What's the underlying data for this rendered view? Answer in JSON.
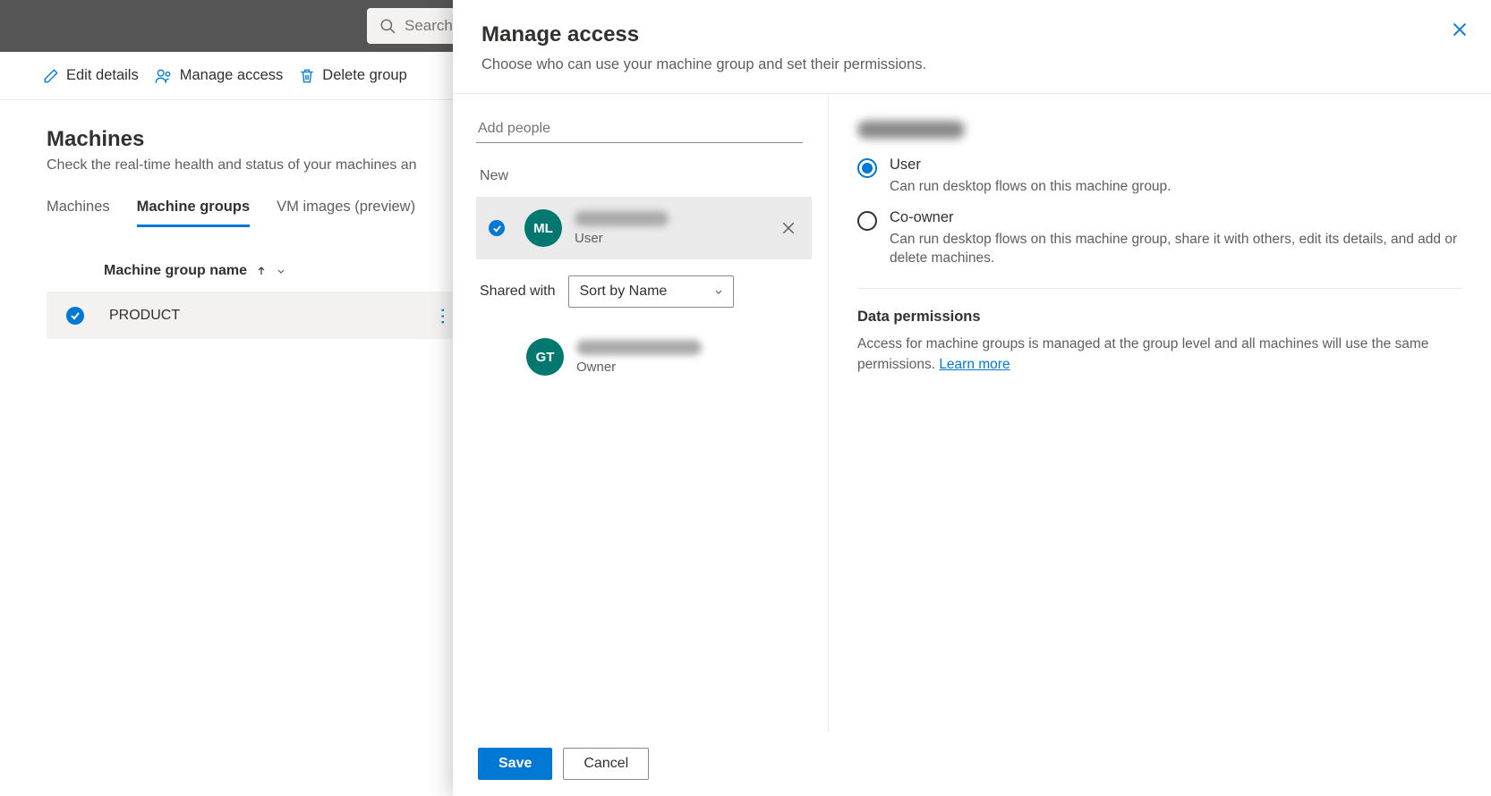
{
  "search": {
    "placeholder": "Search"
  },
  "commands": {
    "edit": "Edit details",
    "manage": "Manage access",
    "delete": "Delete group"
  },
  "page": {
    "title": "Machines",
    "subtitle": "Check the real-time health and status of your machines an"
  },
  "tabs": {
    "machines": "Machines",
    "groups": "Machine groups",
    "vm": "VM images (preview)"
  },
  "table": {
    "col1": "Machine group name",
    "row1_name": "PRODUCT"
  },
  "panel": {
    "title": "Manage access",
    "subtitle": "Choose who can use your machine group and set their permissions.",
    "add_people": "Add people",
    "new_label": "New",
    "new_person": {
      "initials": "ML",
      "role": "User"
    },
    "shared_with": "Shared with",
    "sort_by": "Sort by Name",
    "shared_person": {
      "initials": "GT",
      "role": "Owner"
    },
    "permissions": {
      "user": {
        "label": "User",
        "desc": "Can run desktop flows on this machine group."
      },
      "coowner": {
        "label": "Co-owner",
        "desc": "Can run desktop flows on this machine group, share it with others, edit its details, and add or delete machines."
      }
    },
    "data_perm": {
      "title": "Data permissions",
      "text": "Access for machine groups is managed at the group level and all machines will use the same permissions. ",
      "link": "Learn more"
    },
    "save": "Save",
    "cancel": "Cancel"
  }
}
